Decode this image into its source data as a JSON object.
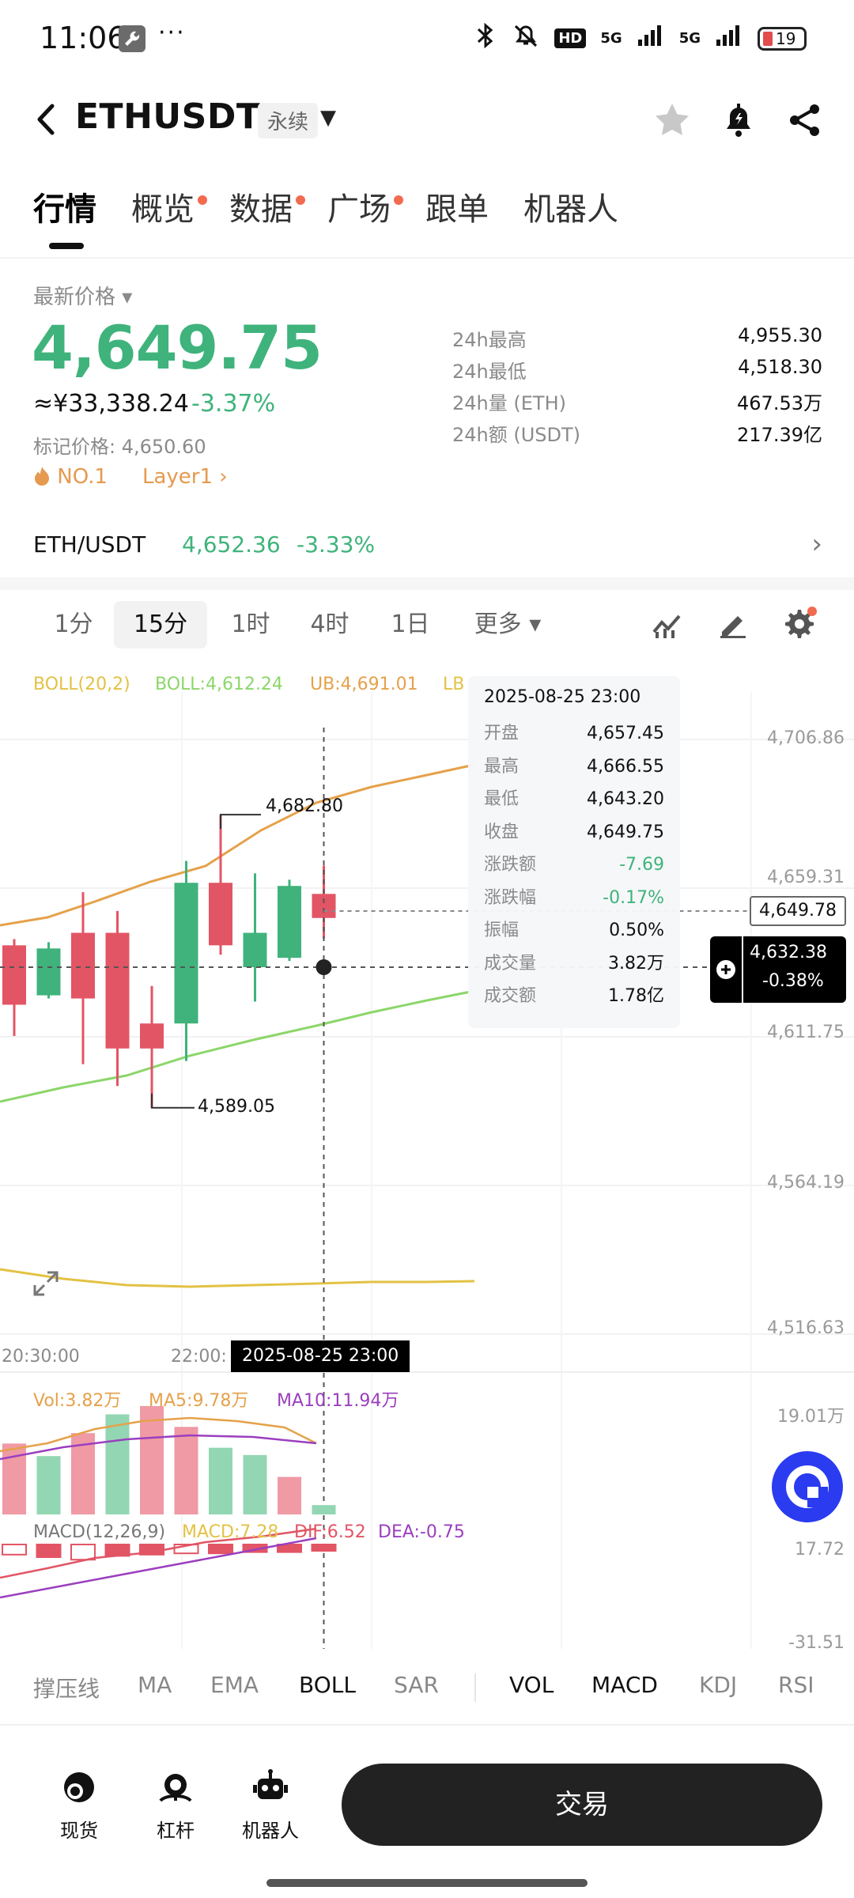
{
  "status_bar": {
    "time": "11:06",
    "more": "···",
    "network_1": "HD",
    "network_2": "5G",
    "network_3": "5G",
    "battery": "19"
  },
  "header": {
    "back": "‹",
    "title": "ETHUSDT",
    "badge": "永续",
    "dropdown": "▼"
  },
  "tabs": [
    {
      "label": "行情",
      "dot": false
    },
    {
      "label": "概览",
      "dot": true
    },
    {
      "label": "数据",
      "dot": true
    },
    {
      "label": "广场",
      "dot": true
    },
    {
      "label": "跟单",
      "dot": false
    },
    {
      "label": "机器人",
      "dot": false
    }
  ],
  "price": {
    "latest_label": "最新价格 ▾",
    "last": "4,649.75",
    "cny": "≈¥33,338.24",
    "change": "-3.37%",
    "mark": "标记价格: 4,650.60",
    "tag_rank": "NO.1",
    "tag_sector": "Layer1 ›"
  },
  "stats": [
    {
      "label": "24h最高",
      "value": "4,955.30"
    },
    {
      "label": "24h最低",
      "value": "4,518.30"
    },
    {
      "label": "24h量 (ETH)",
      "value": "467.53万"
    },
    {
      "label": "24h额 (USDT)",
      "value": "217.39亿"
    }
  ],
  "spot": {
    "pair": "ETH/USDT",
    "price": "4,652.36",
    "change": "-3.33%",
    "arrow": "›"
  },
  "intervals": [
    "1分",
    "15分",
    "1时",
    "4时",
    "1日",
    "更多 ▾"
  ],
  "active_interval": "15分",
  "boll_legend": {
    "name": "BOLL(20,2)",
    "mid": "BOLL:4,612.24",
    "ub": "UB:4,691.01",
    "lb": "LB"
  },
  "tooltip": {
    "date": "2025-08-25 23:00",
    "rows": [
      {
        "k": "开盘",
        "v": "4,657.45"
      },
      {
        "k": "最高",
        "v": "4,666.55"
      },
      {
        "k": "最低",
        "v": "4,643.20"
      },
      {
        "k": "收盘",
        "v": "4,649.75"
      },
      {
        "k": "涨跌额",
        "v": "-7.69"
      },
      {
        "k": "涨跌幅",
        "v": "-0.17%"
      },
      {
        "k": "振幅",
        "v": "0.50%"
      },
      {
        "k": "成交量",
        "v": "3.82万"
      },
      {
        "k": "成交额",
        "v": "1.78亿"
      }
    ]
  },
  "price_axis": [
    "4,706.86",
    "4,659.31",
    "4,611.75",
    "4,564.19",
    "4,516.63"
  ],
  "annotations": {
    "high": "4,682.80",
    "low": "4,589.05"
  },
  "last_price_tag": "4,649.78",
  "crosshair": {
    "price": "4,632.38",
    "pct": "-0.38%",
    "time": "2025-08-25 23:00"
  },
  "time_axis": [
    "20:30:00",
    "22:00:"
  ],
  "vol_legend": {
    "vol": "Vol:3.82万",
    "ma5": "MA5:9.78万",
    "ma10": "MA10:11.94万",
    "axis": "19.01万"
  },
  "macd_legend": {
    "name": "MACD(12,26,9)",
    "macd": "MACD:7.28",
    "dif": "DIF:6.52",
    "dea": "DEA:-0.75",
    "axis_top": "17.72",
    "axis_bottom": "-31.51"
  },
  "chart_data": {
    "type": "candlestick",
    "candles": [
      {
        "open": 4641,
        "close": 4622,
        "high": 4643,
        "low": 4612
      },
      {
        "open": 4625,
        "close": 4640,
        "high": 4642,
        "low": 4624
      },
      {
        "open": 4645,
        "close": 4624,
        "high": 4658,
        "low": 4603
      },
      {
        "open": 4645,
        "close": 4608,
        "high": 4652,
        "low": 4596
      },
      {
        "open": 4616,
        "close": 4608,
        "high": 4628,
        "low": 4589.05
      },
      {
        "open": 4616,
        "close": 4661,
        "high": 4668,
        "low": 4604
      },
      {
        "open": 4661,
        "close": 4641,
        "high": 4682.8,
        "low": 4638
      },
      {
        "open": 4634,
        "close": 4645,
        "high": 4664,
        "low": 4623
      },
      {
        "open": 4637,
        "close": 4660,
        "high": 4662,
        "low": 4636
      },
      {
        "open": 4657.45,
        "close": 4649.75,
        "high": 4666.55,
        "low": 4643.2
      }
    ],
    "volume": [
      6.8,
      5.6,
      7.8,
      9.6,
      10.4,
      8.4,
      6.4,
      5.7,
      3.6,
      0.9
    ],
    "volume_up": [
      false,
      true,
      false,
      true,
      false,
      false,
      true,
      true,
      false,
      true
    ],
    "macd_hist": [
      -8,
      -10,
      -12,
      -9,
      -8,
      -7,
      -7,
      -6,
      -6,
      -5
    ]
  },
  "indicators": [
    "撑压线",
    "MA",
    "EMA",
    "BOLL",
    "SAR",
    "VOL",
    "MACD",
    "KDJ",
    "RSI"
  ],
  "active_indicators": [
    "BOLL",
    "VOL",
    "MACD"
  ],
  "bottom_nav": [
    {
      "label": "现货",
      "icon": "spot-icon"
    },
    {
      "label": "杠杆",
      "icon": "margin-icon"
    },
    {
      "label": "机器人",
      "icon": "robot-icon"
    }
  ],
  "trade_button": "交易",
  "colors": {
    "up": "#3fb37b",
    "down": "#e25565",
    "boll_ub": "#e5a14a",
    "boll_mid": "#8cd66a",
    "boll_lb": "#e3c245",
    "ma10": "#9b3fbf"
  }
}
